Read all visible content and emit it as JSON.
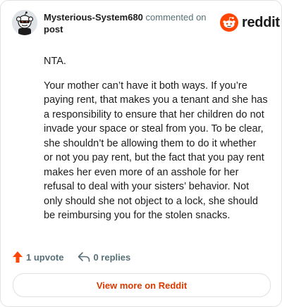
{
  "header": {
    "author": "Mysterious-System680",
    "action": "commented on",
    "post_link": "post",
    "brand_name": "reddit"
  },
  "comment": {
    "paragraphs": [
      "NTA.",
      "Your mother can’t have it both ways. If you’re paying rent, that makes you a tenant and she has a responsibility to ensure that her children do not invade your space or steal from you. To be clear, she shouldn’t be allowing them to do it whether or not you pay rent, but the fact that you pay rent makes her even more of an asshole for her refusal to deal with your sisters’ behavior. Not only should she not object to a lock, she should be reimbursing you for the stolen snacks."
    ]
  },
  "footer": {
    "upvotes": "1 upvote",
    "replies": "0 replies"
  },
  "view_more_label": "View more on Reddit",
  "colors": {
    "brand": "#ff4500",
    "link": "#d93900",
    "muted": "#576f76"
  }
}
